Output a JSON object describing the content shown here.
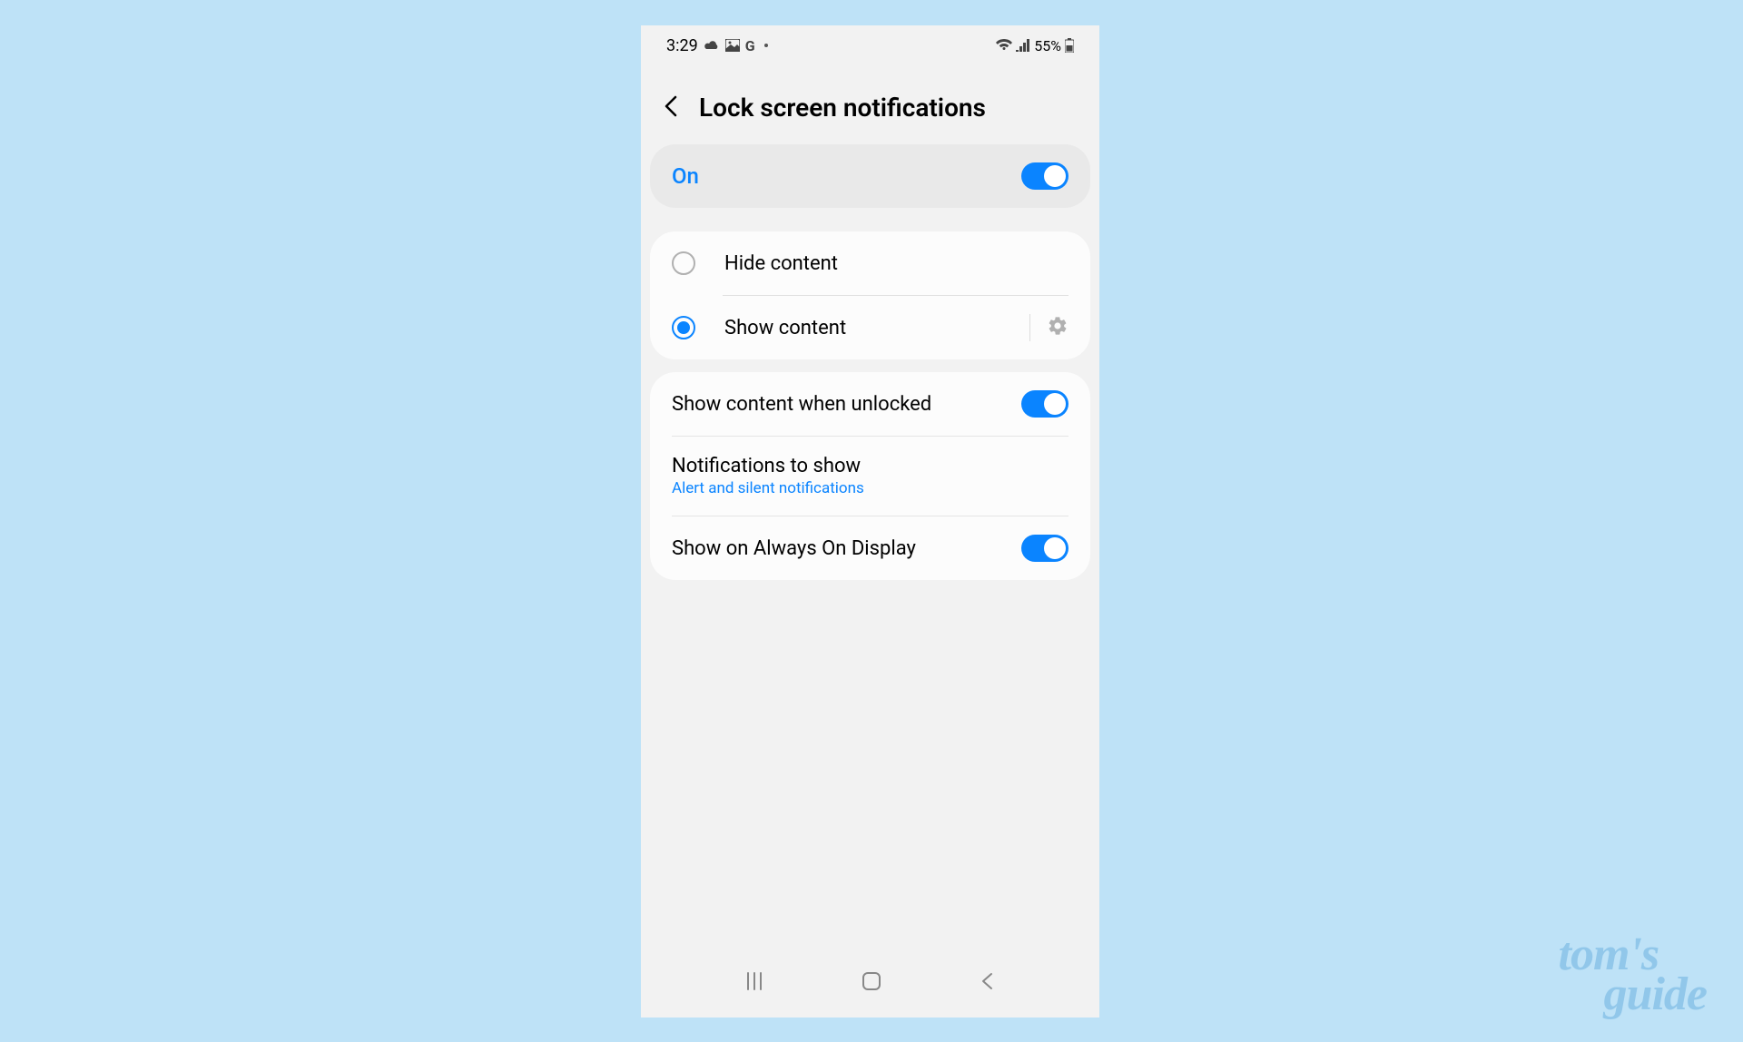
{
  "status": {
    "time": "3:29",
    "battery": "55%"
  },
  "header": {
    "title": "Lock screen notifications"
  },
  "master_toggle": {
    "label": "On",
    "enabled": true
  },
  "content_options": {
    "hide_label": "Hide content",
    "show_label": "Show content",
    "selected": "show"
  },
  "settings": {
    "show_when_unlocked": {
      "label": "Show content when unlocked",
      "enabled": true
    },
    "notifications_to_show": {
      "label": "Notifications to show",
      "value": "Alert and silent notifications"
    },
    "always_on_display": {
      "label": "Show on Always On Display",
      "enabled": true
    }
  },
  "watermark": {
    "line1": "tom's",
    "line2": "guide"
  }
}
